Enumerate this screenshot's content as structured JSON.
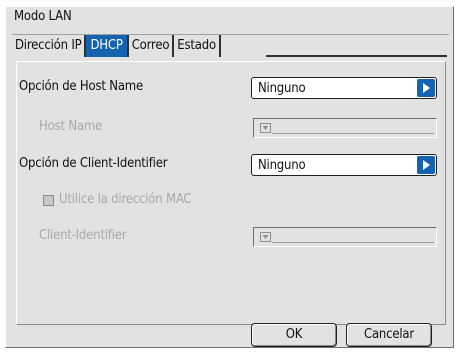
{
  "window": {
    "title": "Modo LAN"
  },
  "tabs": [
    {
      "label": "Dirección IP",
      "active": false
    },
    {
      "label": "DHCP",
      "active": true
    },
    {
      "label": "Correo",
      "active": false
    },
    {
      "label": "Estado",
      "active": false
    }
  ],
  "form": {
    "host_name_option": {
      "label": "Opción de Host Name",
      "value": "Ninguno"
    },
    "host_name": {
      "label": "Host Name",
      "value": ""
    },
    "client_identifier_option": {
      "label": "Opción de Client-Identifier",
      "value": "Ninguno"
    },
    "use_mac": {
      "label": "Utilice la dirección MAC",
      "checked": false
    },
    "client_identifier": {
      "label": "Client-Identifier",
      "value": ""
    }
  },
  "buttons": {
    "ok": "OK",
    "cancel": "Cancelar"
  },
  "colors": {
    "accent": "#1463b0",
    "background": "#e2e2e2",
    "disabled_text": "#a8a8a8"
  },
  "icons": {
    "select_arrow": "triangle-right-icon",
    "field_dropdown": "small-dropdown-icon"
  }
}
